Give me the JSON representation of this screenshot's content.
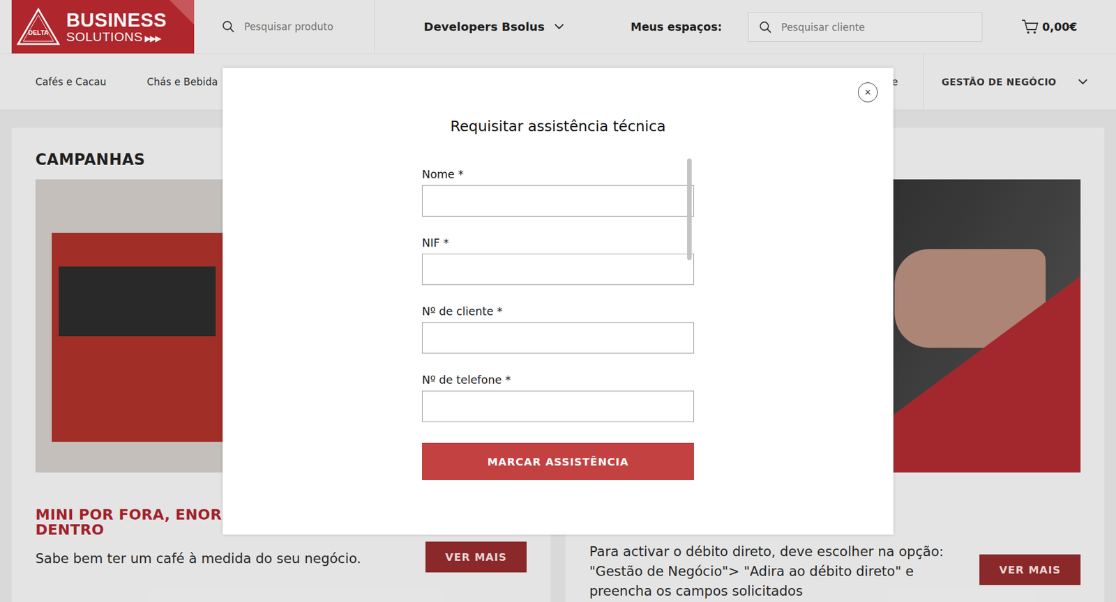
{
  "header": {
    "logo": {
      "brand": "DELTA",
      "title": "BUSINESS",
      "subtitle": "SOLUTIONS",
      "arrows": "▶▶▶"
    },
    "product_search": {
      "placeholder": "Pesquisar produto"
    },
    "account": {
      "label": "Developers Bsolus",
      "expanded": false
    },
    "spaces_label": "Meus espaços:",
    "client_search": {
      "placeholder": "Pesquisar cliente"
    },
    "cart": {
      "total": "0,00€"
    }
  },
  "nav": {
    "items": [
      {
        "label": "Cafés e Cacau",
        "kind": "link"
      },
      {
        "label": "Chás e Bebida",
        "kind": "link"
      },
      {
        "label": "e",
        "kind": "link"
      },
      {
        "label": "GESTÃO DE NEGÓCIO",
        "kind": "dropdown",
        "expanded": false
      }
    ]
  },
  "campaigns": {
    "title": "CAMPANHAS",
    "cards": [
      {
        "title_lines": [
          "MINI POR FORA, ENORM",
          "DENTRO"
        ],
        "text": "Sabe bem ter um café à medida do seu negócio.",
        "button": "VER MAIS"
      },
      {
        "title_lines": [],
        "text": "Para activar o débito direto, deve escolher na opção: \"Gestão de Negócio\"> \"Adira ao débito direto\" e preencha os campos solicitados",
        "button": "VER MAIS"
      }
    ]
  },
  "modal": {
    "title": "Requisitar assistência técnica",
    "close": "×",
    "fields": [
      {
        "label": "Nome *",
        "value": ""
      },
      {
        "label": "NIF *",
        "value": ""
      },
      {
        "label": "Nº de cliente *",
        "value": ""
      },
      {
        "label": "Nº de telefone *",
        "value": ""
      }
    ],
    "submit": "MARCAR ASSISTÊNCIA",
    "scrollbar": {
      "level": 0.38
    }
  }
}
